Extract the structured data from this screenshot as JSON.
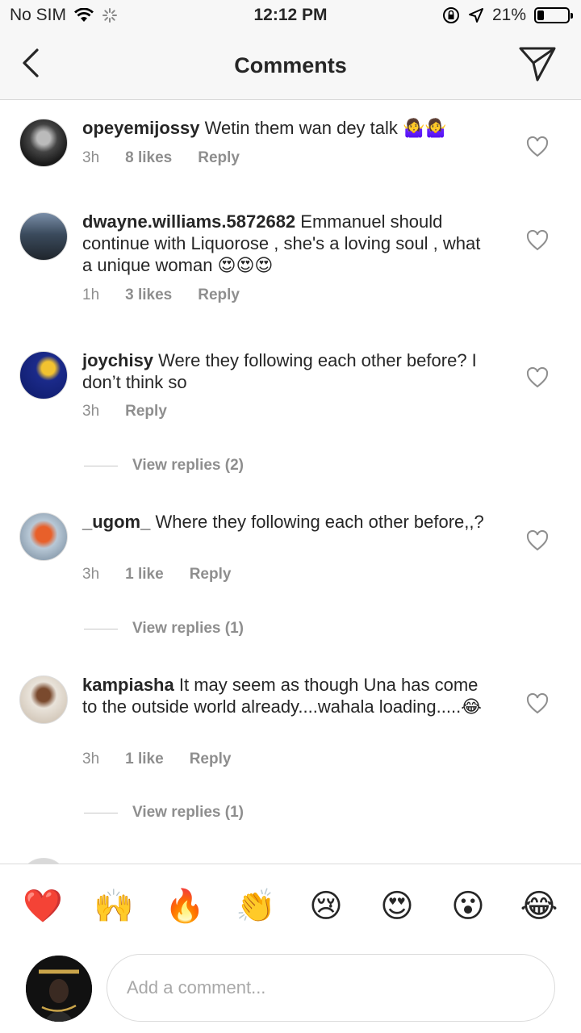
{
  "status_bar": {
    "carrier": "No SIM",
    "time": "12:12 PM",
    "battery": "21%",
    "battery_level": 0.21
  },
  "header": {
    "title": "Comments"
  },
  "comments": [
    {
      "user": "opeyemijossy",
      "text": "Wetin them wan dey talk 🤷‍♀️🤷‍♀️",
      "time": "3h",
      "likes": "8 likes",
      "reply": "Reply"
    },
    {
      "user": "dwayne.williams.5872682",
      "text": "Emmanuel should continue with Liquorose , she's a loving soul , what a unique woman 😍😍😍",
      "time": "1h",
      "likes": "3 likes",
      "reply": "Reply"
    },
    {
      "user": "joychisy",
      "text": "Were they following each other before? I don’t think so",
      "time": "3h",
      "likes": "",
      "reply": "Reply",
      "view_replies": "View replies (2)"
    },
    {
      "user": "_ugom_",
      "text": "Where they following each other before,,?",
      "time": "3h",
      "likes": "1 like",
      "reply": "Reply",
      "view_replies": "View replies (1)"
    },
    {
      "user": "kampiasha",
      "text": "It may seem as though Una has come to the outside world already....wahala loading.....😂",
      "time": "3h",
      "likes": "1 like",
      "reply": "Reply",
      "view_replies": "View replies (1)"
    }
  ],
  "reactions": [
    "❤️",
    "🙌",
    "🔥",
    "👏",
    "😢",
    "😍",
    "😮",
    "😂"
  ],
  "composer": {
    "placeholder": "Add a comment..."
  },
  "colors": {
    "accent_red": "#ed4956",
    "text": "#262626",
    "meta": "#8e8e8e"
  }
}
